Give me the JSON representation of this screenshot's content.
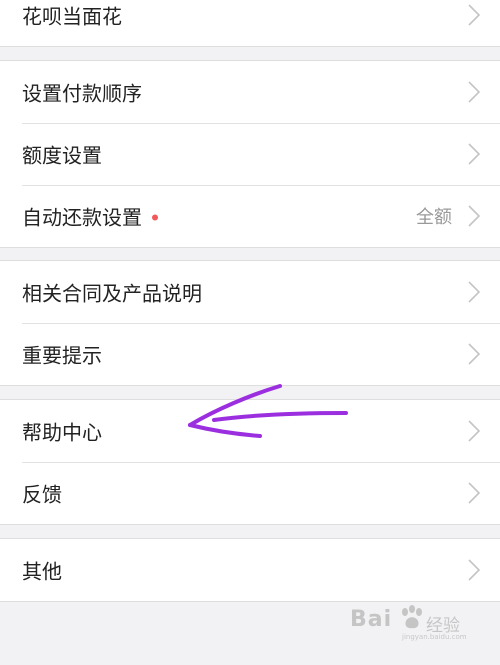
{
  "groups": [
    {
      "items": [
        {
          "label": "花呗当面花"
        }
      ]
    },
    {
      "items": [
        {
          "label": "设置付款顺序"
        },
        {
          "label": "额度设置"
        },
        {
          "label": "自动还款设置",
          "value": "全额"
        }
      ]
    },
    {
      "items": [
        {
          "label": "相关合同及产品说明"
        },
        {
          "label": "重要提示"
        }
      ]
    },
    {
      "items": [
        {
          "label": "帮助中心"
        },
        {
          "label": "反馈"
        }
      ]
    },
    {
      "items": [
        {
          "label": "其他"
        }
      ]
    }
  ],
  "watermark": {
    "brand": "Bai",
    "brand2": "经验",
    "url": "jingyan.baidu.com"
  },
  "colors": {
    "background": "#f2f2f4",
    "notification_dot": "#f25a5a",
    "annotation_arrow": "#9b2fe0"
  }
}
